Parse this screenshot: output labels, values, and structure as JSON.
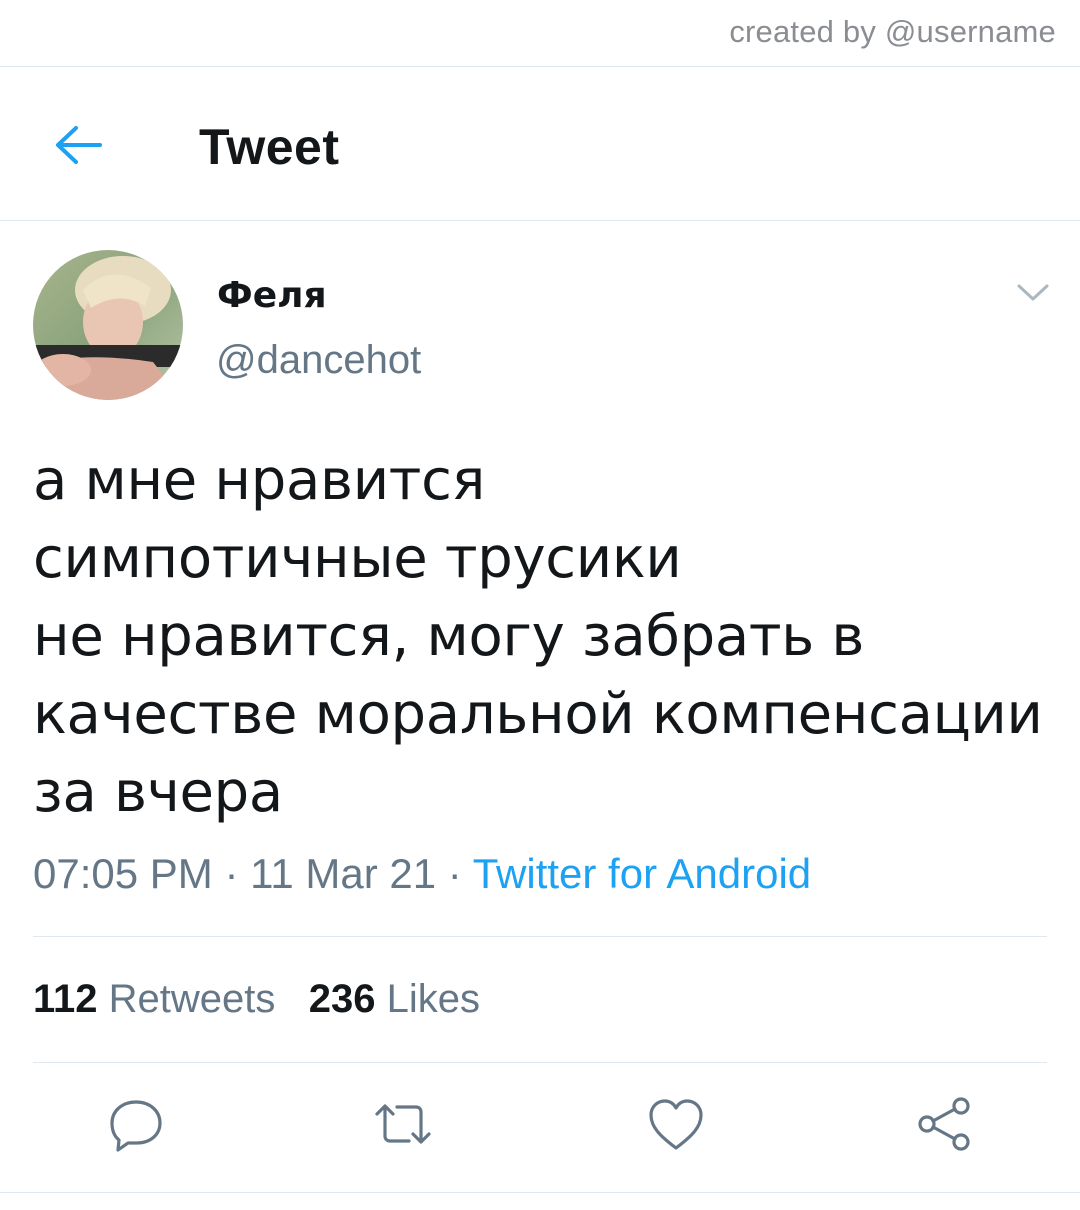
{
  "watermark": "created by @username",
  "header": {
    "title": "Tweet",
    "back_icon": "arrow-left-icon"
  },
  "tweet": {
    "author_name": "Феля",
    "author_handle": "@dancehot",
    "text_lines": [
      "а мне нравится",
      "симпотичные трусики",
      "не нравится, могу забрать в",
      "качестве моральной компенсации",
      "за вчера"
    ],
    "time": "07:05 PM",
    "date": "11 Mar 21",
    "separator": " · ",
    "source": "Twitter for Android"
  },
  "stats": {
    "retweets_count": "112",
    "retweets_label": "Retweets",
    "likes_count": "236",
    "likes_label": "Likes"
  },
  "actions": [
    "reply-icon",
    "retweet-icon",
    "like-icon",
    "share-icon"
  ],
  "colors": {
    "accent": "#1da1f2",
    "text": "#14171a",
    "muted": "#657786",
    "divider": "#e1e8ed"
  }
}
